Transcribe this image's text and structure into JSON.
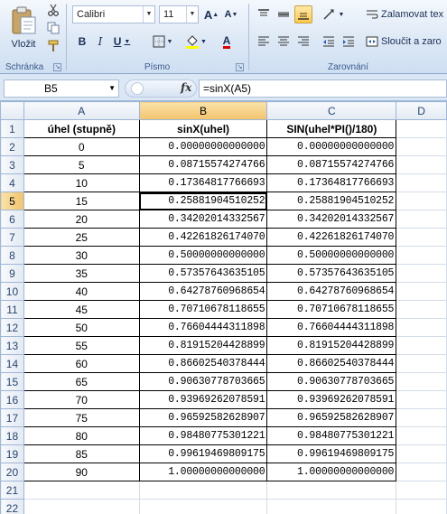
{
  "ribbon": {
    "clipboard": {
      "paste_label": "Vložit",
      "group_label": "Schránka"
    },
    "font": {
      "font_name": "Calibri",
      "font_size": "11",
      "bold": "B",
      "italic": "I",
      "underline": "U",
      "grow": "A",
      "shrink": "A",
      "font_color": "A",
      "group_label": "Písmo"
    },
    "alignment": {
      "wrap_text": "Zalamovat tex",
      "merge": "Sloučit a zaro",
      "group_label": "Zarovnání"
    }
  },
  "formula_bar": {
    "name_box": "B5",
    "fx": "fx",
    "formula": "=sinX(A5)"
  },
  "grid": {
    "columns": [
      "A",
      "B",
      "C",
      "D"
    ],
    "headers": [
      "úhel (stupně)",
      "sinX(uhel)",
      "SIN(uhel*PI()/180)"
    ],
    "rows": [
      [
        "0",
        "0.00000000000000",
        "0.00000000000000"
      ],
      [
        "5",
        "0.08715574274766",
        "0.08715574274766"
      ],
      [
        "10",
        "0.17364817766693",
        "0.17364817766693"
      ],
      [
        "15",
        "0.25881904510252",
        "0.25881904510252"
      ],
      [
        "20",
        "0.34202014332567",
        "0.34202014332567"
      ],
      [
        "25",
        "0.42261826174070",
        "0.42261826174070"
      ],
      [
        "30",
        "0.50000000000000",
        "0.50000000000000"
      ],
      [
        "35",
        "0.57357643635105",
        "0.57357643635105"
      ],
      [
        "40",
        "0.64278760968654",
        "0.64278760968654"
      ],
      [
        "45",
        "0.70710678118655",
        "0.70710678118655"
      ],
      [
        "50",
        "0.76604444311898",
        "0.76604444311898"
      ],
      [
        "55",
        "0.81915204428899",
        "0.81915204428899"
      ],
      [
        "60",
        "0.86602540378444",
        "0.86602540378444"
      ],
      [
        "65",
        "0.90630778703665",
        "0.90630778703665"
      ],
      [
        "70",
        "0.93969262078591",
        "0.93969262078591"
      ],
      [
        "75",
        "0.96592582628907",
        "0.96592582628907"
      ],
      [
        "80",
        "0.98480775301221",
        "0.98480775301221"
      ],
      [
        "85",
        "0.99619469809175",
        "0.99619469809175"
      ],
      [
        "90",
        "1.00000000000000",
        "1.00000000000000"
      ]
    ],
    "row_numbers": [
      "1",
      "2",
      "3",
      "4",
      "5",
      "6",
      "7",
      "8",
      "9",
      "10",
      "11",
      "12",
      "13",
      "14",
      "15",
      "16",
      "17",
      "18",
      "19",
      "20",
      "21",
      "22"
    ],
    "selected_cell": "B5"
  },
  "colors": {
    "accent": "#f2c36c",
    "ribbon_bg": "#dbe7f5",
    "header_text": "#27466f"
  }
}
